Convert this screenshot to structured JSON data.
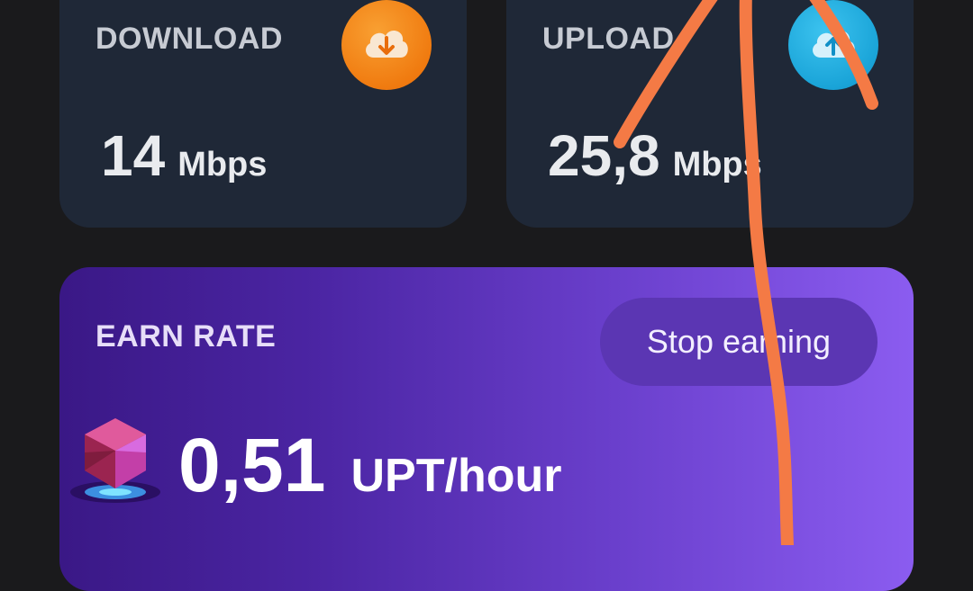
{
  "download": {
    "label": "DOWNLOAD",
    "value": "14",
    "unit": "Mbps",
    "icon": "cloud-download-icon",
    "color": "#f07b10"
  },
  "upload": {
    "label": "UPLOAD",
    "value": "25,8",
    "unit": "Mbps",
    "icon": "cloud-upload-icon",
    "color": "#1aa4d8"
  },
  "earn": {
    "label": "EARN RATE",
    "button_label": "Stop earning",
    "value": "0,51",
    "unit": "UPT/hour",
    "icon": "gem-icon"
  },
  "colors": {
    "background": "#1a1a1c",
    "card": "#1f2837",
    "earn_gradient_start": "#3a1886",
    "earn_gradient_end": "#8b5cf0",
    "annotation": "#f47a45"
  }
}
